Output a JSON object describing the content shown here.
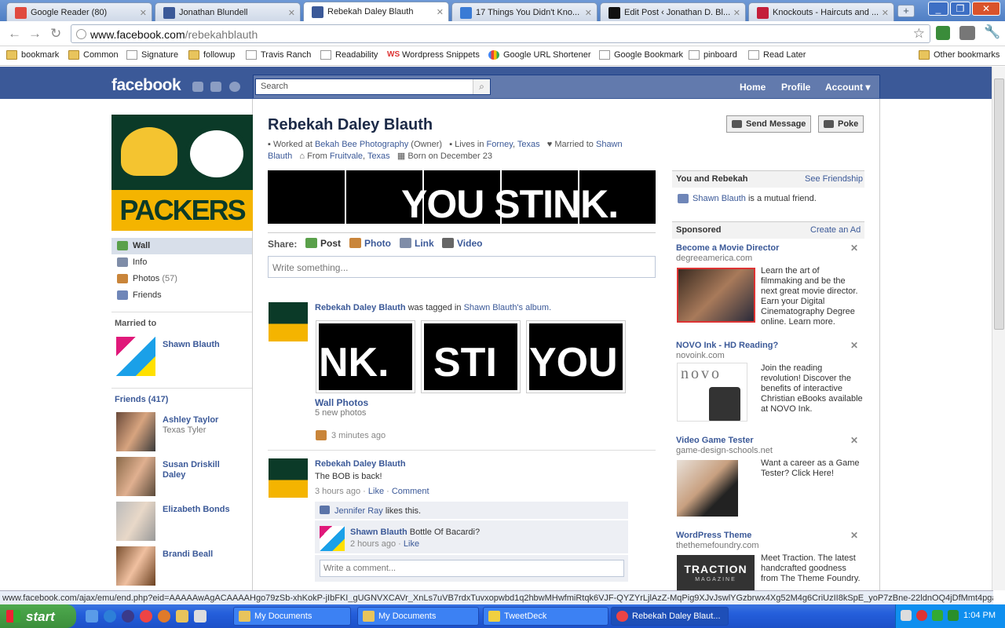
{
  "browser": {
    "tabs": [
      {
        "title": "Google Reader (80)",
        "color": "#e04a3f"
      },
      {
        "title": "Jonathan Blundell",
        "color": "#3b5998"
      },
      {
        "title": "Rebekah Daley Blauth",
        "color": "#3b5998"
      },
      {
        "title": "17 Things You Didn't Kno...",
        "color": "#3a7bd5"
      },
      {
        "title": "Edit Post ‹ Jonathan D. Bl...",
        "color": "#111111"
      },
      {
        "title": "Knockouts - Haircuts and ...",
        "color": "#c41e3a"
      }
    ],
    "new_tab": "+",
    "url_host": "www.facebook.com",
    "url_path": "/rebekahblauth",
    "bookmarks": [
      {
        "label": "bookmark",
        "kind": "folder"
      },
      {
        "label": "Common",
        "kind": "folder"
      },
      {
        "label": "Signature",
        "kind": "page"
      },
      {
        "label": "followup",
        "kind": "folder"
      },
      {
        "label": "Travis Ranch",
        "kind": "page"
      },
      {
        "label": "Readability",
        "kind": "page"
      },
      {
        "label": "Wordpress Snippets",
        "kind": "ws"
      },
      {
        "label": "Google URL Shortener",
        "kind": "google"
      },
      {
        "label": "Google Bookmark",
        "kind": "page"
      },
      {
        "label": "pinboard",
        "kind": "page"
      },
      {
        "label": "Read Later",
        "kind": "page"
      }
    ],
    "other_bookmarks": "Other bookmarks",
    "status_url": "www.facebook.com/ajax/emu/end.php?eid=AAAAAwAgACAAAAHgo79zSb-xhKokP-jIbFKI_gUGNVXCAVr_XnLs7uVB7rdxTuvxopwbd1q2hbwMHwfmiRtqk6VJF-QYZYrLjlAzZ-MqPig9XJvJswlYGzbrwx4Xg52M4g6CriUzII8kSpE_yoP7zBne-22ldnOQ4jDfMmt4pgaO16w..."
  },
  "facebook": {
    "logo": "facebook",
    "search_placeholder": "Search",
    "nav": [
      "Home",
      "Profile",
      "Account"
    ],
    "profile_name": "Rebekah Daley Blauth",
    "info": {
      "work_pre": "Worked at",
      "work": "Bekah Bee Photography",
      "work_post": "(Owner)",
      "lives_pre": "Lives in",
      "lives_city": "Forney",
      "lives_state": "Texas",
      "married_pre": "Married to",
      "married": "Shawn Blauth",
      "from_pre": "From",
      "from_city": "Fruitvale",
      "from_state": "Texas",
      "born": "Born on December 23"
    },
    "buttons": {
      "message": "Send Message",
      "poke": "Poke"
    },
    "profile_pic_text": "PACKERS",
    "banner_text": "YOU STINK.",
    "left_nav": [
      {
        "label": "Wall",
        "count": ""
      },
      {
        "label": "Info",
        "count": ""
      },
      {
        "label": "Photos",
        "count": "(57)"
      },
      {
        "label": "Friends",
        "count": ""
      }
    ],
    "married_to_heading": "Married to",
    "spouse": "Shawn Blauth",
    "friends_heading": "Friends (417)",
    "friends": [
      {
        "name": "Ashley Taylor",
        "sub": "Texas Tyler"
      },
      {
        "name": "Susan Driskill Daley",
        "sub": ""
      },
      {
        "name": "Elizabeth Bonds",
        "sub": ""
      },
      {
        "name": "Brandi Beall",
        "sub": ""
      }
    ],
    "share": {
      "label": "Share:",
      "post": "Post",
      "photo": "Photo",
      "link": "Link",
      "video": "Video",
      "write_placeholder": "Write something..."
    },
    "story1": {
      "author": "Rebekah Daley Blauth",
      "action": "was tagged in",
      "owner": "Shawn Blauth's",
      "album": "album.",
      "photos": [
        "NK.",
        "STI",
        "YOU"
      ],
      "album_title": "Wall Photos",
      "album_count": "5 new photos",
      "time": "3 minutes ago"
    },
    "story2": {
      "author": "Rebekah Daley Blauth",
      "text": "The BOB is back!",
      "time": "3 hours ago",
      "like": "Like",
      "comment": "Comment",
      "liker": "Jennifer Ray",
      "likes_text": "likes this.",
      "commenter": "Shawn Blauth",
      "comment_text": "Bottle Of Bacardi?",
      "comment_time": "2 hours ago",
      "comment_like": "Like",
      "write_comment": "Write a comment..."
    },
    "right": {
      "you_and": "You and Rebekah",
      "see_friendship": "See Friendship",
      "mutual_name": "Shawn Blauth",
      "mutual_text": "is a mutual friend.",
      "sponsored": "Sponsored",
      "create_ad": "Create an Ad",
      "ads": [
        {
          "title": "Become a Movie Director",
          "url": "degreeamerica.com",
          "text": "Learn the art of filmmaking and be the next great movie director. Earn your Digital Cinematography Degree online. Learn more."
        },
        {
          "title": "NOVO Ink - HD Reading?",
          "url": "novoink.com",
          "text": "Join the reading revolution! Discover the benefits of interactive Christian eBooks available at NOVO Ink.",
          "img_text": "novo"
        },
        {
          "title": "Video Game Tester",
          "url": "game-design-schools.net",
          "text": "Want a career as a Game Tester? Click Here!"
        },
        {
          "title": "WordPress Theme",
          "url": "thethemefoundry.com",
          "text": "Meet Traction. The latest handcrafted goodness from The Theme Foundry.",
          "img_text": "TRACTION",
          "img_sub": "MAGAZINE"
        }
      ]
    }
  },
  "taskbar": {
    "start": "start",
    "tasks": [
      "My Documents",
      "My Documents",
      "TweetDeck",
      "Rebekah Daley Blaut..."
    ],
    "clock": "1:04 PM"
  }
}
